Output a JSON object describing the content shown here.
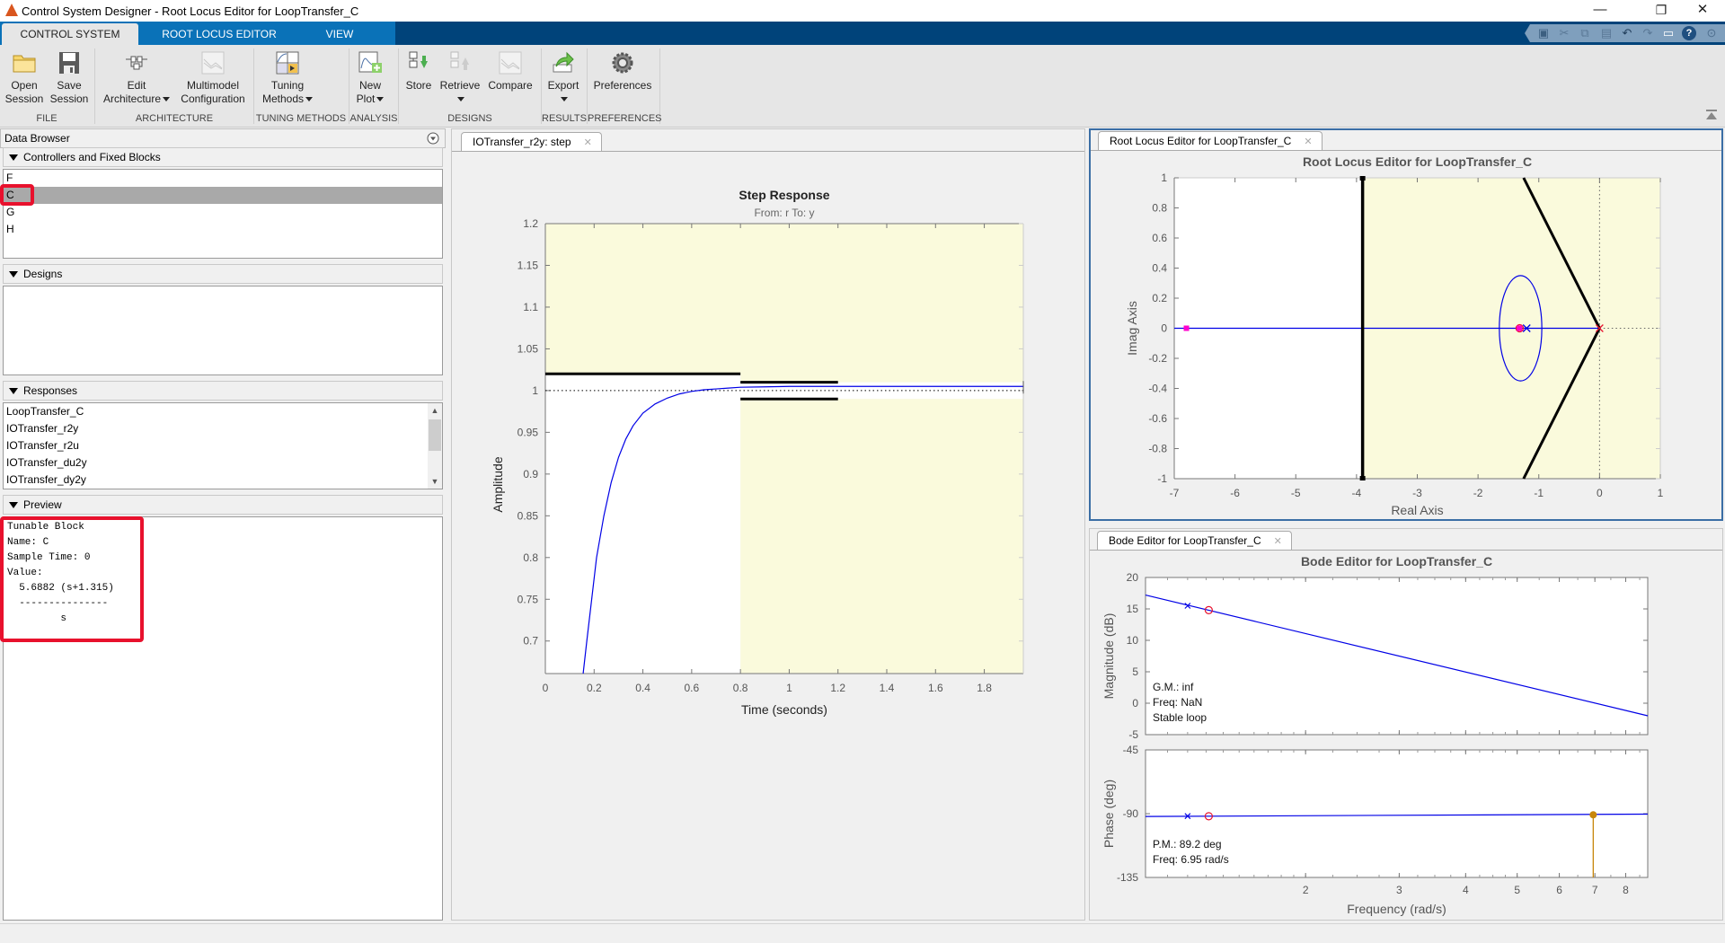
{
  "window": {
    "title": "Control System Designer - Root Locus Editor for LoopTransfer_C",
    "controls": {
      "minimize": "—",
      "restore": "❐",
      "close": "✕"
    }
  },
  "ribbon_tabs": [
    {
      "label": "CONTROL SYSTEM",
      "active": true
    },
    {
      "label": "ROOT LOCUS EDITOR",
      "active": false
    },
    {
      "label": "VIEW",
      "active": false
    }
  ],
  "quick_access": [
    "save-icon",
    "cut-icon",
    "copy-icon",
    "paste-icon",
    "undo-icon",
    "redo-icon",
    "window-layout-icon",
    "help-icon",
    "options-icon"
  ],
  "ribbon": {
    "buttons": {
      "open_session": {
        "line1": "Open",
        "line2": "Session"
      },
      "save_session": {
        "line1": "Save",
        "line2": "Session"
      },
      "edit_architecture": {
        "line1": "Edit",
        "line2": "Architecture"
      },
      "multimodel": {
        "line1": "Multimodel",
        "line2": "Configuration"
      },
      "tuning_methods": {
        "line1": "Tuning",
        "line2": "Methods"
      },
      "new_plot": {
        "line1": "New",
        "line2": "Plot"
      },
      "store": {
        "line1": "Store"
      },
      "retrieve": {
        "line1": "Retrieve"
      },
      "compare": {
        "line1": "Compare"
      },
      "export": {
        "line1": "Export"
      },
      "preferences": {
        "line1": "Preferences"
      }
    },
    "groups": {
      "file": "FILE",
      "architecture": "ARCHITECTURE",
      "tuning": "TUNING METHODS",
      "analysis": "ANALYSIS",
      "designs": "DESIGNS",
      "results": "RESULTS",
      "preferences": "PREFERENCES"
    }
  },
  "data_browser": {
    "title": "Data Browser",
    "controllers": {
      "header": "Controllers and Fixed Blocks",
      "items": [
        "F",
        "C",
        "G",
        "H"
      ],
      "selected": "C"
    },
    "designs": {
      "header": "Designs",
      "items": []
    },
    "responses": {
      "header": "Responses",
      "items": [
        "LoopTransfer_C",
        "IOTransfer_r2y",
        "IOTransfer_r2u",
        "IOTransfer_du2y",
        "IOTransfer_dy2y"
      ]
    },
    "preview": {
      "header": "Preview",
      "lines": [
        "Tunable Block",
        "Name: C",
        "Sample Time: 0",
        "Value:",
        "  5.6882 (s+1.315)",
        "  ---------------",
        "         s"
      ]
    }
  },
  "center_tab": {
    "label": "IOTransfer_r2y: step",
    "close": "✕"
  },
  "right_tabs": {
    "root_locus": {
      "label": "Root Locus Editor for LoopTransfer_C",
      "close": "✕"
    },
    "bode": {
      "label": "Bode Editor for LoopTransfer_C",
      "close": "✕"
    }
  },
  "colors": {
    "accent_tab_blue": "#0a72b8",
    "tabstrip_dark": "#00437a",
    "response_line": "#0000e6",
    "constraint_region": "#fafadc",
    "pole_zero_red": "#e8112d",
    "closed_loop_pole": "#ff00cc",
    "margin_marker": "#c8860a"
  },
  "chart_data": [
    {
      "id": "step",
      "type": "line",
      "title": "Step Response",
      "subtitle": "From: r  To: y",
      "xlabel": "Time (seconds)",
      "ylabel": "Amplitude",
      "xlim": [
        0,
        1.96
      ],
      "ylim": [
        0.661,
        1.2
      ],
      "xticks": [
        0,
        0.2,
        0.4,
        0.6,
        0.8,
        1,
        1.2,
        1.4,
        1.6,
        1.8
      ],
      "xtick_labels": [
        "0",
        "0.2",
        "0.4",
        "0.6",
        "0.8",
        "1",
        "1.2",
        "1.4",
        "1.6",
        "1.8"
      ],
      "yticks": [
        0.7,
        0.75,
        0.8,
        0.85,
        0.9,
        0.95,
        1,
        1.05,
        1.1,
        1.15,
        1.2
      ],
      "ytick_labels": [
        "0.7",
        "0.75",
        "0.8",
        "0.85",
        "0.9",
        "0.95",
        "1",
        "1.05",
        "1.1",
        "1.15",
        "1.2"
      ],
      "reference_line": 1,
      "series": [
        {
          "name": "IOTransfer_r2y",
          "x": [
            0.155,
            0.17,
            0.19,
            0.21,
            0.24,
            0.27,
            0.3,
            0.33,
            0.36,
            0.4,
            0.45,
            0.5,
            0.55,
            0.6,
            0.65,
            0.7,
            0.75,
            0.8,
            0.9,
            1.0,
            1.2,
            1.5,
            1.96
          ],
          "y": [
            0.661,
            0.7,
            0.75,
            0.8,
            0.85,
            0.89,
            0.92,
            0.942,
            0.958,
            0.973,
            0.984,
            0.991,
            0.996,
            0.999,
            1.001,
            1.002,
            1.003,
            1.004,
            1.0045,
            1.005,
            1.005,
            1.005,
            1.005
          ]
        }
      ],
      "constraints": {
        "overshoot_upper": {
          "x": [
            0,
            0.8
          ],
          "y": 1.02
        },
        "settling_upper": {
          "x": [
            0.8,
            1.2
          ],
          "y": 1.01
        },
        "settling_lower": {
          "x": [
            0.8,
            1.2
          ],
          "y": 0.99
        },
        "settle_band_after": {
          "x": [
            1.2,
            1.96
          ],
          "upper": 1.01,
          "lower": 0.99
        }
      },
      "grid": false
    },
    {
      "id": "root_locus",
      "type": "scatter",
      "title": "Root Locus Editor for LoopTransfer_C",
      "xlabel": "Real Axis",
      "ylabel": "Imag Axis",
      "xlim": [
        -7,
        1
      ],
      "ylim": [
        -1,
        1
      ],
      "xticks": [
        -7,
        -6,
        -5,
        -4,
        -3,
        -2,
        -1,
        0,
        1
      ],
      "xtick_labels": [
        "-7",
        "-6",
        "-5",
        "-4",
        "-3",
        "-2",
        "-1",
        "0",
        "1"
      ],
      "yticks": [
        -1,
        -0.8,
        -0.6,
        -0.4,
        -0.2,
        0,
        0.2,
        0.4,
        0.6,
        0.8,
        1
      ],
      "ytick_labels": [
        "-1",
        "-0.8",
        "-0.6",
        "-0.4",
        "-0.2",
        "0",
        "0.2",
        "0.4",
        "0.6",
        "0.8",
        "1"
      ],
      "open_loop_poles": [
        [
          0,
          0
        ],
        [
          -1.2,
          0
        ]
      ],
      "open_loop_zeros": [
        [
          -1.315,
          0
        ]
      ],
      "closed_loop_poles": [
        [
          -6.8,
          0
        ],
        [
          -1.32,
          0
        ]
      ],
      "locus_circle": {
        "center": [
          -1.3,
          0
        ],
        "radius_real": 0.35,
        "radius_imag": 0.35
      },
      "settling_boundary_real": -3.9,
      "damping_lines": [
        {
          "from": [
            0,
            0
          ],
          "to": [
            -1.25,
            1
          ]
        },
        {
          "from": [
            0,
            0
          ],
          "to": [
            -1.25,
            -1
          ]
        }
      ],
      "stability_boundary_real": 0
    },
    {
      "id": "bode_magnitude",
      "type": "line",
      "title": "Bode Editor for LoopTransfer_C",
      "ylabel": "Magnitude (dB)",
      "xscale": "log",
      "xlim": [
        1.0,
        8.8
      ],
      "ylim": [
        -5,
        20
      ],
      "yticks": [
        -5,
        0,
        5,
        10,
        15,
        20
      ],
      "ytick_labels": [
        "-5",
        "0",
        "5",
        "10",
        "15",
        "20"
      ],
      "series": [
        {
          "name": "LoopTransfer_C",
          "x": [
            1.0,
            8.8
          ],
          "y": [
            17.2,
            -2.0
          ]
        }
      ],
      "pole_marker": {
        "x": 1.2,
        "y": 15.5
      },
      "zero_marker": {
        "x": 1.315,
        "y": 14.8
      },
      "annotations": [
        "G.M.: inf",
        "Freq: NaN",
        "Stable loop"
      ]
    },
    {
      "id": "bode_phase",
      "type": "line",
      "ylabel": "Phase (deg)",
      "xlabel": "Frequency (rad/s)",
      "xscale": "log",
      "xlim": [
        1.0,
        8.8
      ],
      "ylim": [
        -135,
        -45
      ],
      "xticks": [
        2,
        3,
        4,
        5,
        6,
        7,
        8
      ],
      "xtick_labels": [
        "2",
        "3",
        "4",
        "5",
        "6",
        "7",
        "8"
      ],
      "yticks": [
        -135,
        -90,
        -45
      ],
      "ytick_labels": [
        "-135",
        "-90",
        "-45"
      ],
      "series": [
        {
          "name": "LoopTransfer_C",
          "x": [
            1.0,
            8.8
          ],
          "y": [
            -92.0,
            -90.3
          ]
        }
      ],
      "pole_marker": {
        "x": 1.2,
        "y": -91.7
      },
      "zero_marker": {
        "x": 1.315,
        "y": -91.8
      },
      "margin_marker": {
        "x": 6.95,
        "y": -90.8
      },
      "annotations": [
        "P.M.: 89.2 deg",
        "Freq: 6.95 rad/s"
      ]
    }
  ]
}
